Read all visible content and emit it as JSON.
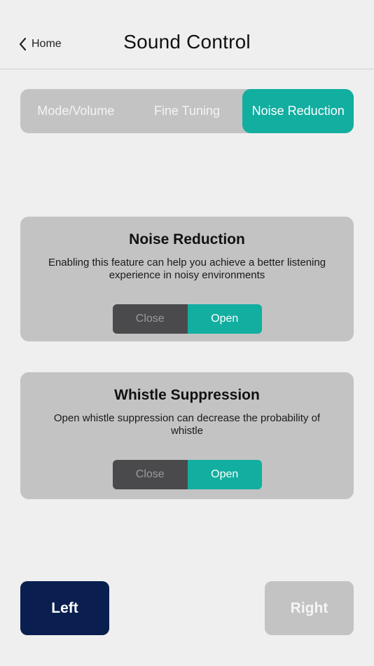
{
  "header": {
    "back_label": "Home",
    "back_icon": "chevron-left-icon",
    "title": "Sound Control"
  },
  "tabs": [
    {
      "label": "Mode/Volume",
      "active": false
    },
    {
      "label": "Fine Tuning",
      "active": false
    },
    {
      "label": "Noise Reduction",
      "active": true
    }
  ],
  "noise_reduction": {
    "title": "Noise Reduction",
    "description": "Enabling this feature can help you achieve a better listening experience in noisy environments",
    "close_label": "Close",
    "open_label": "Open",
    "selected": "Open"
  },
  "whistle_suppression": {
    "title": "Whistle Suppression",
    "description": "Open whistle suppression can decrease the probability of whistle",
    "close_label": "Close",
    "open_label": "Open",
    "selected": "Open"
  },
  "sides": {
    "left_label": "Left",
    "right_label": "Right",
    "selected": "Left"
  },
  "colors": {
    "accent": "#12aea0",
    "selected_side": "#0a1f50",
    "panel": "#c3c3c3",
    "background": "#efefef"
  }
}
